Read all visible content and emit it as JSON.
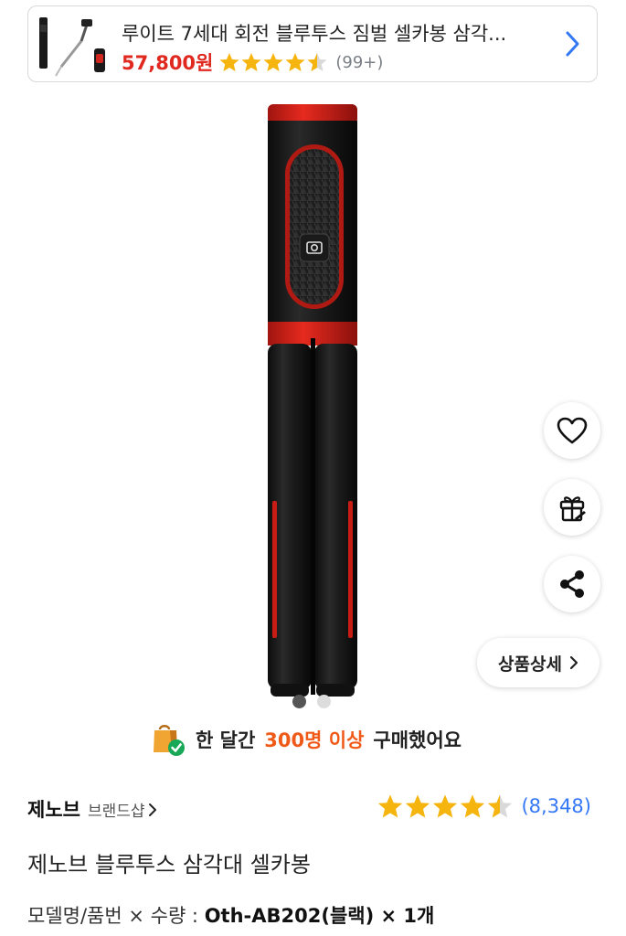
{
  "recommendation": {
    "title": "루이트 7세대 회전 블루투스 짐벌 셀카봉 삼각...",
    "price": "57,800원",
    "rating": 4.5,
    "review_count": "(99+)"
  },
  "purchase_notice": {
    "prefix": "한 달간",
    "highlight": "300명 이상",
    "suffix": "구매했어요"
  },
  "actions": {
    "detail_label": "상품상세"
  },
  "gallery": {
    "total_images": 2,
    "current_index": 0
  },
  "product": {
    "brand": "제노브",
    "brand_shop_label": "브랜드샵",
    "rating": 4.5,
    "review_count": "(8,348)",
    "title": "제노브 블루투스 삼각대 셀카봉",
    "option_label": "모델명/품번 × 수량 :",
    "option_value": "Oth-AB202(블랙) × 1개"
  },
  "colors": {
    "price_red": "#e0281e",
    "star_gold": "#f6b40e",
    "link_blue": "#3478f6",
    "highlight_orange": "#f05a19"
  }
}
